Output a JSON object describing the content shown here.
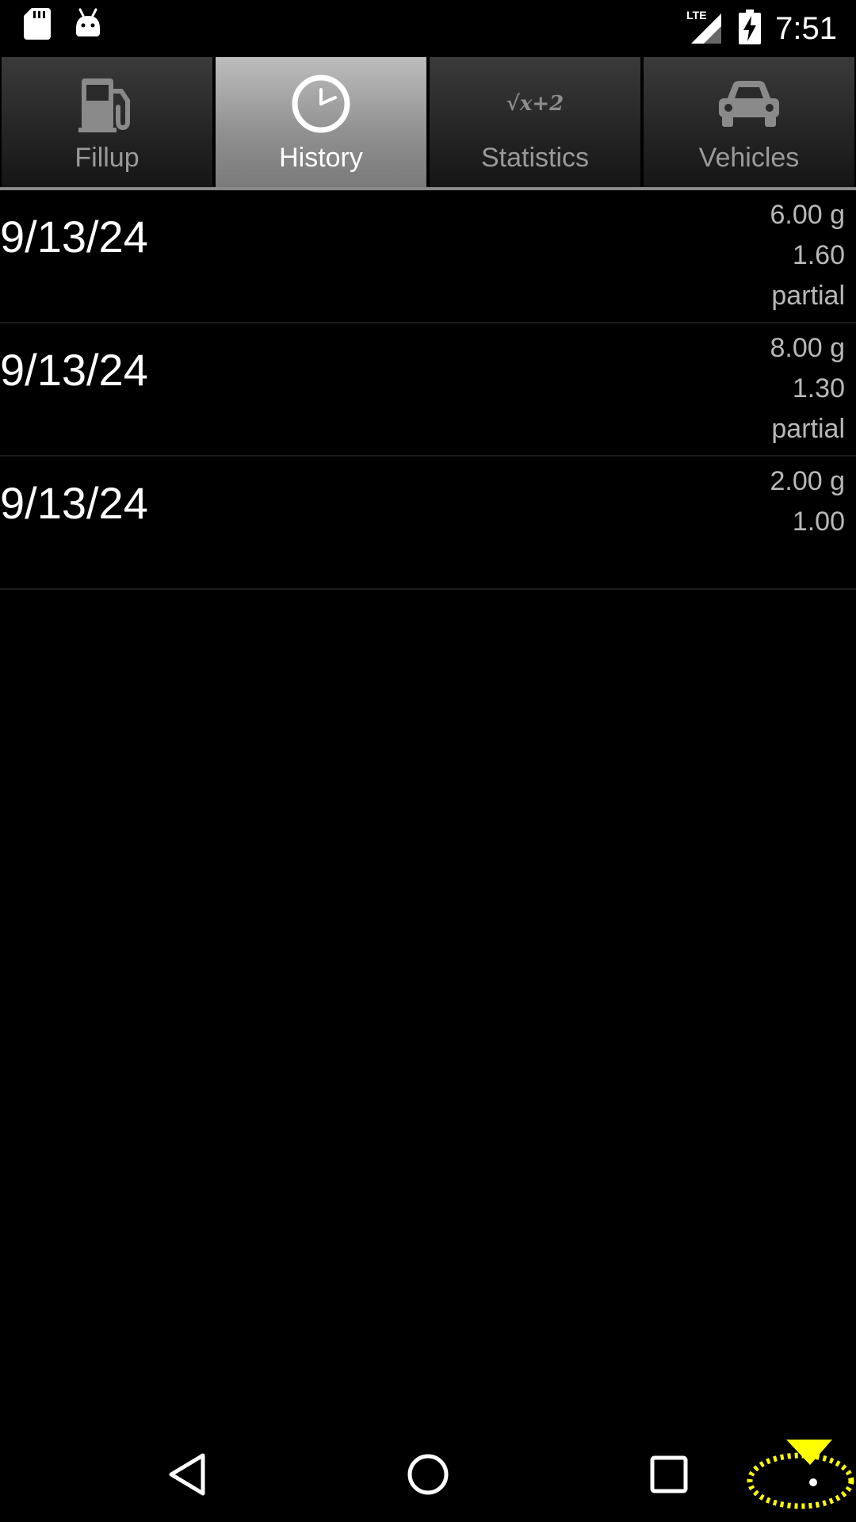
{
  "status_bar": {
    "time": "7:51",
    "network": "LTE",
    "icons": [
      "sd-card-icon",
      "android-icon",
      "lte-signal-icon",
      "battery-charging-icon"
    ]
  },
  "tabs": [
    {
      "label": "Fillup",
      "icon": "fuel-pump-icon",
      "active": false
    },
    {
      "label": "History",
      "icon": "clock-icon",
      "active": true
    },
    {
      "label": "Statistics",
      "icon": "sqrt-formula-icon",
      "icon_text": "√x+2",
      "active": false
    },
    {
      "label": "Vehicles",
      "icon": "car-icon",
      "active": false
    }
  ],
  "history": [
    {
      "date": "9/13/24",
      "amount": "6.00 g",
      "price": "1.60",
      "note": "partial"
    },
    {
      "date": "9/13/24",
      "amount": "8.00 g",
      "price": "1.30",
      "note": "partial"
    },
    {
      "date": "9/13/24",
      "amount": "2.00 g",
      "price": "1.00",
      "note": ""
    }
  ],
  "nav_bar": {
    "buttons": [
      "back-icon",
      "home-icon",
      "recents-icon"
    ]
  },
  "colors": {
    "background": "#000000",
    "active_tab": "#a8a8a8",
    "inactive_label": "#9a9a9a",
    "secondary_text": "#b8b8b8",
    "overlay_marker": "#ffff00"
  }
}
